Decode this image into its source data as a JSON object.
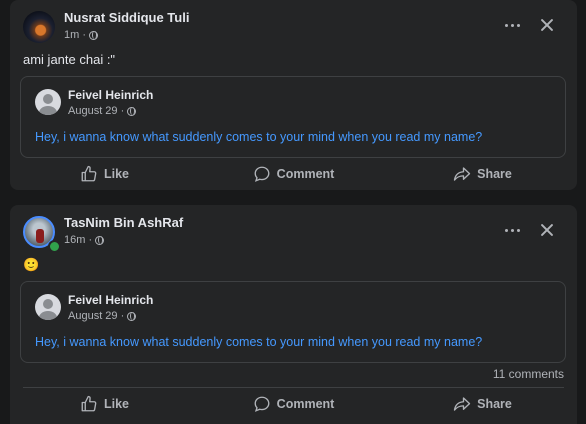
{
  "posts": [
    {
      "author": "Nusrat Siddique Tuli",
      "time": "1m ·",
      "text": "ami jante chai :\"",
      "shared": {
        "author": "Feivel Heinrich",
        "date": "August 29 ·",
        "text": "Hey, i wanna know what suddenly comes to your mind when you read my name?"
      },
      "actions": {
        "like": "Like",
        "comment": "Comment",
        "share": "Share"
      }
    },
    {
      "author": "TasNim Bin AshRaf",
      "time": "16m ·",
      "text": "🙂",
      "shared": {
        "author": "Feivel Heinrich",
        "date": "August 29 ·",
        "text": "Hey, i wanna know what suddenly comes to your mind when you read my name?"
      },
      "comments_count": "11 comments",
      "actions": {
        "like": "Like",
        "comment": "Comment",
        "share": "Share"
      }
    }
  ],
  "icons": {
    "more": "more-options-icon",
    "close": "close-icon",
    "privacy": "globe-icon",
    "like": "thumbs-up-icon",
    "comment": "speech-bubble-icon",
    "share": "share-arrow-icon"
  },
  "colors": {
    "background": "#18191a",
    "card": "#242526",
    "link": "#4599ff",
    "online": "#31a24c"
  }
}
